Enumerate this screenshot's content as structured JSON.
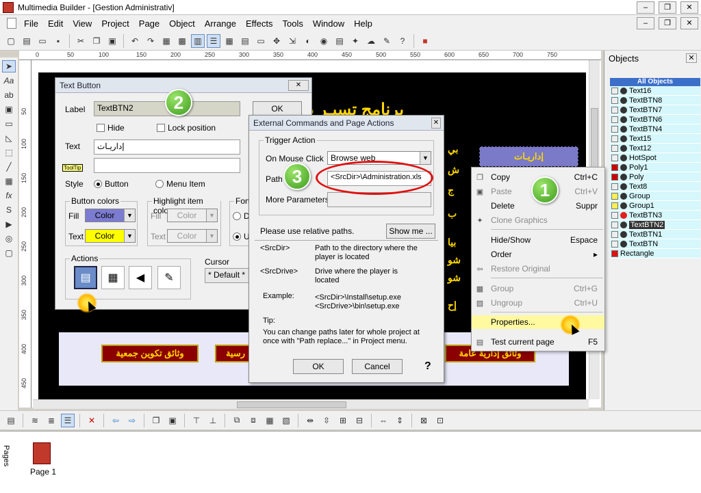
{
  "window": {
    "title": "Multimedia Builder - [Gestion Administrativ]",
    "min": "–",
    "max": "❐",
    "close": "✕"
  },
  "menu": [
    "File",
    "Edit",
    "View",
    "Project",
    "Page",
    "Object",
    "Arrange",
    "Effects",
    "Tools",
    "Window",
    "Help"
  ],
  "ruler": {
    "h_ticks": [
      "0",
      "50",
      "100",
      "150",
      "200",
      "250",
      "300",
      "350",
      "400",
      "450",
      "500",
      "550",
      "600",
      "650",
      "700",
      "750"
    ],
    "v_ticks": [
      "50",
      "100",
      "150",
      "200",
      "250",
      "300",
      "350",
      "400",
      "450"
    ]
  },
  "canvas": {
    "title": "برنامج تسيـر م",
    "selected_button": "إداريـات",
    "bottom_buttons": [
      "وثائق تكوين جمعية",
      "رسية",
      "وثائق إدارية عامة"
    ]
  },
  "objects_panel": {
    "title": "Objects",
    "header": "All Objects",
    "items": [
      {
        "name": "Text16",
        "selected": false
      },
      {
        "name": "TextBTN8",
        "selected": false
      },
      {
        "name": "TextBTN7",
        "selected": false
      },
      {
        "name": "TextBTN6",
        "selected": false
      },
      {
        "name": "TextBTN4",
        "selected": false
      },
      {
        "name": "Text15",
        "selected": false
      },
      {
        "name": "Text12",
        "selected": false
      },
      {
        "name": "HotSpot",
        "selected": false
      },
      {
        "name": "Poly1",
        "selected": false
      },
      {
        "name": "Poly",
        "selected": false
      },
      {
        "name": "Text8",
        "selected": false
      },
      {
        "name": "Group",
        "selected": false
      },
      {
        "name": "Group1",
        "selected": false
      },
      {
        "name": "TextBTN3",
        "selected": false
      },
      {
        "name": "TextBTN2",
        "selected": true
      },
      {
        "name": "TextBTN1",
        "selected": false
      },
      {
        "name": "TextBTN",
        "selected": false
      },
      {
        "name": "Rectangle",
        "selected": false
      }
    ]
  },
  "text_button_dialog": {
    "title": "Text Button",
    "label_caption": "Label",
    "label_value": "TextBTN2",
    "ok": "OK",
    "hide": "Hide",
    "lock_position": "Lock position",
    "text_caption": "Text",
    "text_value": "إداريـات",
    "tooltip_caption": "ToolTip",
    "style_caption": "Style",
    "style_button": "Button",
    "style_menu_item": "Menu Item",
    "button_colors": "Button colors",
    "highlight_colors": "Highlight item colors",
    "font_caption": "Font",
    "fill": "Fill",
    "text": "Text",
    "color": "Color",
    "fill_color": "#7b7bd0",
    "text_color": "#ffff00",
    "actions": "Actions",
    "cursor": "Cursor",
    "cursor_value": "* Default *",
    "font_radio_d": "D",
    "font_radio_u": "U"
  },
  "ext_dialog": {
    "title": "External Commands and Page Actions",
    "trigger_action": "Trigger Action",
    "on_mouse_click": "On Mouse Click",
    "action_value": "Browse web",
    "path_caption": "Path",
    "path_value": "<SrcDir>\\Administration.xls",
    "more_params": "More Parameters",
    "relative_paths": "Please use relative paths.",
    "show_me": "Show me ...",
    "srcdir": "<SrcDir>",
    "srcdir_desc": "Path to the directory where the player is located",
    "srcdrive": "<SrcDrive>",
    "srcdrive_desc": "Drive where the player is located",
    "example": "Example:",
    "example_1": "<SrcDir>\\Install\\setup.exe",
    "example_2": "<SrcDrive>\\bin\\setup.exe",
    "tip": "Tip:",
    "tip_text": "You can change paths later for whole project  at once with \"Path replace...\" in Project menu.",
    "ok": "OK",
    "cancel": "Cancel",
    "help": "?"
  },
  "context_menu": {
    "items": [
      {
        "label": "Copy",
        "shortcut": "Ctrl+C",
        "disabled": false
      },
      {
        "label": "Paste",
        "shortcut": "Ctrl+V",
        "disabled": true
      },
      {
        "label": "Delete",
        "shortcut": "Suppr",
        "disabled": false
      },
      {
        "label": "Clone Graphics",
        "shortcut": "",
        "disabled": true
      },
      {
        "label": "Hide/Show",
        "shortcut": "Espace",
        "disabled": false
      },
      {
        "label": "Order",
        "shortcut": "▸",
        "disabled": false
      },
      {
        "label": "Restore Original",
        "shortcut": "",
        "disabled": true
      },
      {
        "label": "Group",
        "shortcut": "Ctrl+G",
        "disabled": true
      },
      {
        "label": "Ungroup",
        "shortcut": "Ctrl+U",
        "disabled": true
      },
      {
        "label": "Properties...",
        "shortcut": "",
        "disabled": false
      },
      {
        "label": "Test current page",
        "shortcut": "F5",
        "disabled": false
      }
    ]
  },
  "badges": [
    "1",
    "2",
    "3"
  ],
  "pages_panel": {
    "title": "Pages",
    "page_label": "Page 1"
  }
}
